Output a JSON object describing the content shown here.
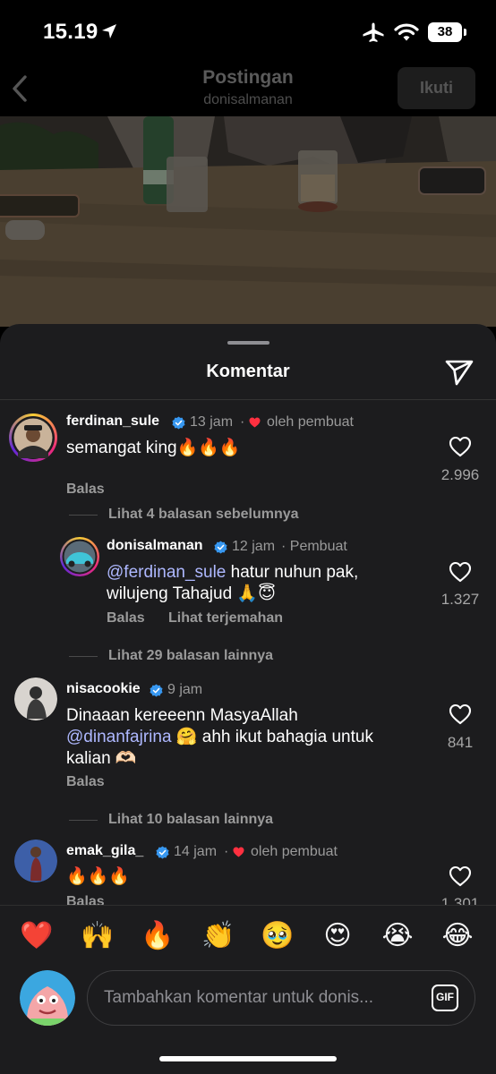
{
  "status_bar": {
    "time": "15.19",
    "battery": "38"
  },
  "header": {
    "title": "Postingan",
    "subtitle": "donisalmanan",
    "follow_label": "Ikuti"
  },
  "sheet": {
    "title": "Komentar"
  },
  "comments": [
    {
      "username": "ferdinan_sule",
      "time": "13 jam",
      "by_creator_label": "oleh pembuat",
      "text": "semangat king🔥🔥🔥",
      "reply_label": "Balas",
      "likes": "2.996",
      "view_replies": "Lihat 4 balasan sebelumnya"
    },
    {
      "username": "donisalmanan",
      "time": "12 jam",
      "creator_label": "· Pembuat",
      "mention": "@ferdinan_sule",
      "text_line1": " hatur nuhun pak,",
      "text_line2": "wilujeng Tahajud 🙏😇",
      "reply_label": "Balas",
      "translate_label": "Lihat terjemahan",
      "likes": "1.327",
      "view_replies": "Lihat 29 balasan lainnya"
    },
    {
      "username": "nisacookie",
      "time": "9 jam",
      "text_line1": "Dinaaan kereeenn MasyaAllah",
      "mention": "@dinanfajrina",
      "text_line2": " 🤗 ahh ikut bahagia untuk",
      "text_line3": "kalian 🫶🏻",
      "reply_label": "Balas",
      "likes": "841",
      "view_replies": "Lihat 10 balasan lainnya"
    },
    {
      "username": "emak_gila_",
      "time": "14 jam",
      "by_creator_label": "oleh pembuat",
      "text": "🔥🔥🔥",
      "reply_label": "Balas",
      "likes": "1.301"
    }
  ],
  "emoji_bar": [
    "❤️",
    "🙌",
    "🔥",
    "👏",
    "🥹",
    "😍",
    "😭",
    "😂"
  ],
  "input": {
    "placeholder": "Tambahkan komentar untuk donis...",
    "gif_label": "GIF"
  },
  "colors": {
    "sheet_bg": "#1c1c1e",
    "verified": "#3797f0",
    "mention": "#aeb8ff",
    "heart": "#ff3040"
  }
}
